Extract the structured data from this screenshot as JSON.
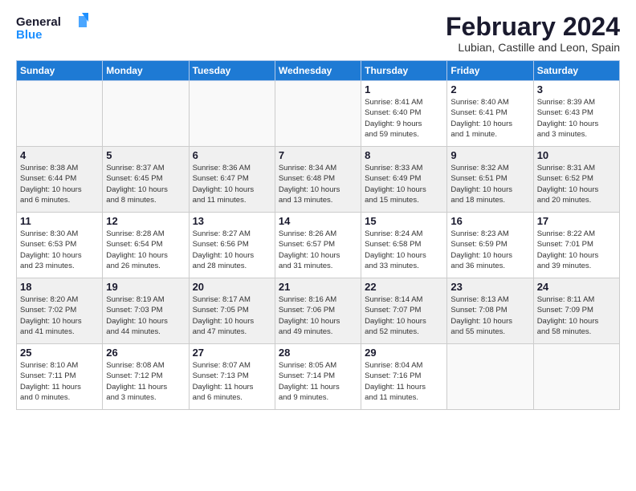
{
  "header": {
    "logo_line1": "General",
    "logo_line2": "Blue",
    "month_title": "February 2024",
    "location": "Lubian, Castille and Leon, Spain"
  },
  "weekdays": [
    "Sunday",
    "Monday",
    "Tuesday",
    "Wednesday",
    "Thursday",
    "Friday",
    "Saturday"
  ],
  "weeks": [
    [
      {
        "day": "",
        "info": ""
      },
      {
        "day": "",
        "info": ""
      },
      {
        "day": "",
        "info": ""
      },
      {
        "day": "",
        "info": ""
      },
      {
        "day": "1",
        "info": "Sunrise: 8:41 AM\nSunset: 6:40 PM\nDaylight: 9 hours\nand 59 minutes."
      },
      {
        "day": "2",
        "info": "Sunrise: 8:40 AM\nSunset: 6:41 PM\nDaylight: 10 hours\nand 1 minute."
      },
      {
        "day": "3",
        "info": "Sunrise: 8:39 AM\nSunset: 6:43 PM\nDaylight: 10 hours\nand 3 minutes."
      }
    ],
    [
      {
        "day": "4",
        "info": "Sunrise: 8:38 AM\nSunset: 6:44 PM\nDaylight: 10 hours\nand 6 minutes."
      },
      {
        "day": "5",
        "info": "Sunrise: 8:37 AM\nSunset: 6:45 PM\nDaylight: 10 hours\nand 8 minutes."
      },
      {
        "day": "6",
        "info": "Sunrise: 8:36 AM\nSunset: 6:47 PM\nDaylight: 10 hours\nand 11 minutes."
      },
      {
        "day": "7",
        "info": "Sunrise: 8:34 AM\nSunset: 6:48 PM\nDaylight: 10 hours\nand 13 minutes."
      },
      {
        "day": "8",
        "info": "Sunrise: 8:33 AM\nSunset: 6:49 PM\nDaylight: 10 hours\nand 15 minutes."
      },
      {
        "day": "9",
        "info": "Sunrise: 8:32 AM\nSunset: 6:51 PM\nDaylight: 10 hours\nand 18 minutes."
      },
      {
        "day": "10",
        "info": "Sunrise: 8:31 AM\nSunset: 6:52 PM\nDaylight: 10 hours\nand 20 minutes."
      }
    ],
    [
      {
        "day": "11",
        "info": "Sunrise: 8:30 AM\nSunset: 6:53 PM\nDaylight: 10 hours\nand 23 minutes."
      },
      {
        "day": "12",
        "info": "Sunrise: 8:28 AM\nSunset: 6:54 PM\nDaylight: 10 hours\nand 26 minutes."
      },
      {
        "day": "13",
        "info": "Sunrise: 8:27 AM\nSunset: 6:56 PM\nDaylight: 10 hours\nand 28 minutes."
      },
      {
        "day": "14",
        "info": "Sunrise: 8:26 AM\nSunset: 6:57 PM\nDaylight: 10 hours\nand 31 minutes."
      },
      {
        "day": "15",
        "info": "Sunrise: 8:24 AM\nSunset: 6:58 PM\nDaylight: 10 hours\nand 33 minutes."
      },
      {
        "day": "16",
        "info": "Sunrise: 8:23 AM\nSunset: 6:59 PM\nDaylight: 10 hours\nand 36 minutes."
      },
      {
        "day": "17",
        "info": "Sunrise: 8:22 AM\nSunset: 7:01 PM\nDaylight: 10 hours\nand 39 minutes."
      }
    ],
    [
      {
        "day": "18",
        "info": "Sunrise: 8:20 AM\nSunset: 7:02 PM\nDaylight: 10 hours\nand 41 minutes."
      },
      {
        "day": "19",
        "info": "Sunrise: 8:19 AM\nSunset: 7:03 PM\nDaylight: 10 hours\nand 44 minutes."
      },
      {
        "day": "20",
        "info": "Sunrise: 8:17 AM\nSunset: 7:05 PM\nDaylight: 10 hours\nand 47 minutes."
      },
      {
        "day": "21",
        "info": "Sunrise: 8:16 AM\nSunset: 7:06 PM\nDaylight: 10 hours\nand 49 minutes."
      },
      {
        "day": "22",
        "info": "Sunrise: 8:14 AM\nSunset: 7:07 PM\nDaylight: 10 hours\nand 52 minutes."
      },
      {
        "day": "23",
        "info": "Sunrise: 8:13 AM\nSunset: 7:08 PM\nDaylight: 10 hours\nand 55 minutes."
      },
      {
        "day": "24",
        "info": "Sunrise: 8:11 AM\nSunset: 7:09 PM\nDaylight: 10 hours\nand 58 minutes."
      }
    ],
    [
      {
        "day": "25",
        "info": "Sunrise: 8:10 AM\nSunset: 7:11 PM\nDaylight: 11 hours\nand 0 minutes."
      },
      {
        "day": "26",
        "info": "Sunrise: 8:08 AM\nSunset: 7:12 PM\nDaylight: 11 hours\nand 3 minutes."
      },
      {
        "day": "27",
        "info": "Sunrise: 8:07 AM\nSunset: 7:13 PM\nDaylight: 11 hours\nand 6 minutes."
      },
      {
        "day": "28",
        "info": "Sunrise: 8:05 AM\nSunset: 7:14 PM\nDaylight: 11 hours\nand 9 minutes."
      },
      {
        "day": "29",
        "info": "Sunrise: 8:04 AM\nSunset: 7:16 PM\nDaylight: 11 hours\nand 11 minutes."
      },
      {
        "day": "",
        "info": ""
      },
      {
        "day": "",
        "info": ""
      }
    ]
  ]
}
